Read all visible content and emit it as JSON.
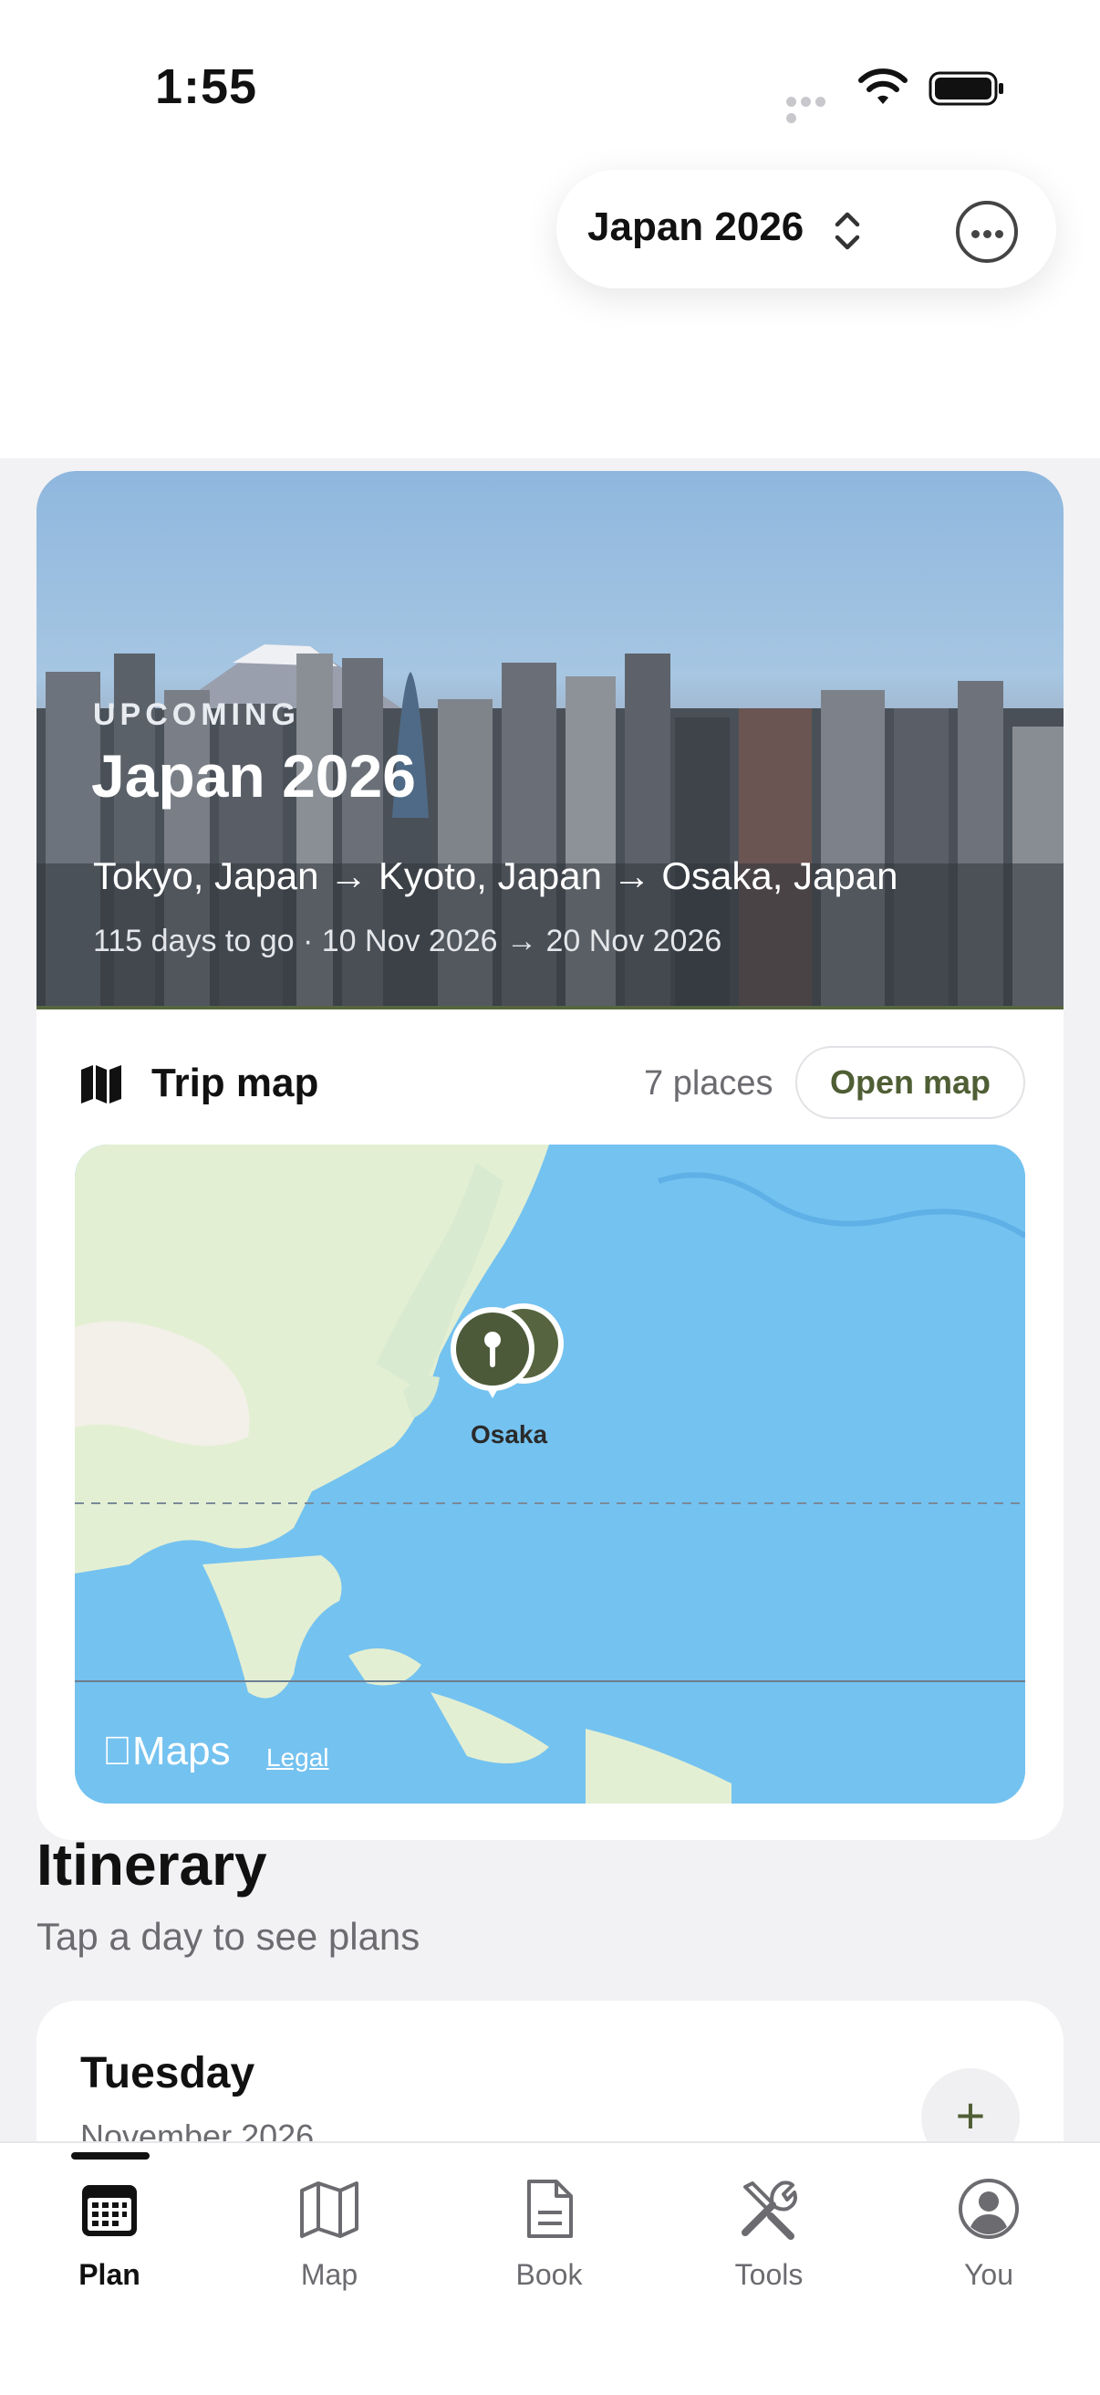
{
  "status_bar": {
    "time": "1:55"
  },
  "trip_switcher": {
    "name": "Japan 2026"
  },
  "hero": {
    "label": "UPCOMING",
    "title": "Japan 2026",
    "route": "Tokyo, Japan → Kyoto, Japan → Osaka, Japan",
    "meta": "115 days to go · 10 Nov 2026 → 20 Nov 2026"
  },
  "trip_map": {
    "title": "Trip map",
    "count": "7 places",
    "open_label": "Open map",
    "place_label": "Osaka",
    "maps_brand": "Maps",
    "legal": "Legal"
  },
  "itinerary": {
    "title": "Itinerary",
    "subtitle": "Tap a day to see plans",
    "days": [
      {
        "name": "Tuesday",
        "month": "November 2026"
      }
    ]
  },
  "tabs": [
    {
      "label": "Plan",
      "icon": "calendar-icon",
      "active": true
    },
    {
      "label": "Map",
      "icon": "map-icon"
    },
    {
      "label": "Book",
      "icon": "document-icon"
    },
    {
      "label": "Tools",
      "icon": "tools-icon"
    },
    {
      "label": "You",
      "icon": "person-icon"
    }
  ],
  "colors": {
    "accent": "#4f5e34",
    "pin": "#4c5a3a"
  }
}
